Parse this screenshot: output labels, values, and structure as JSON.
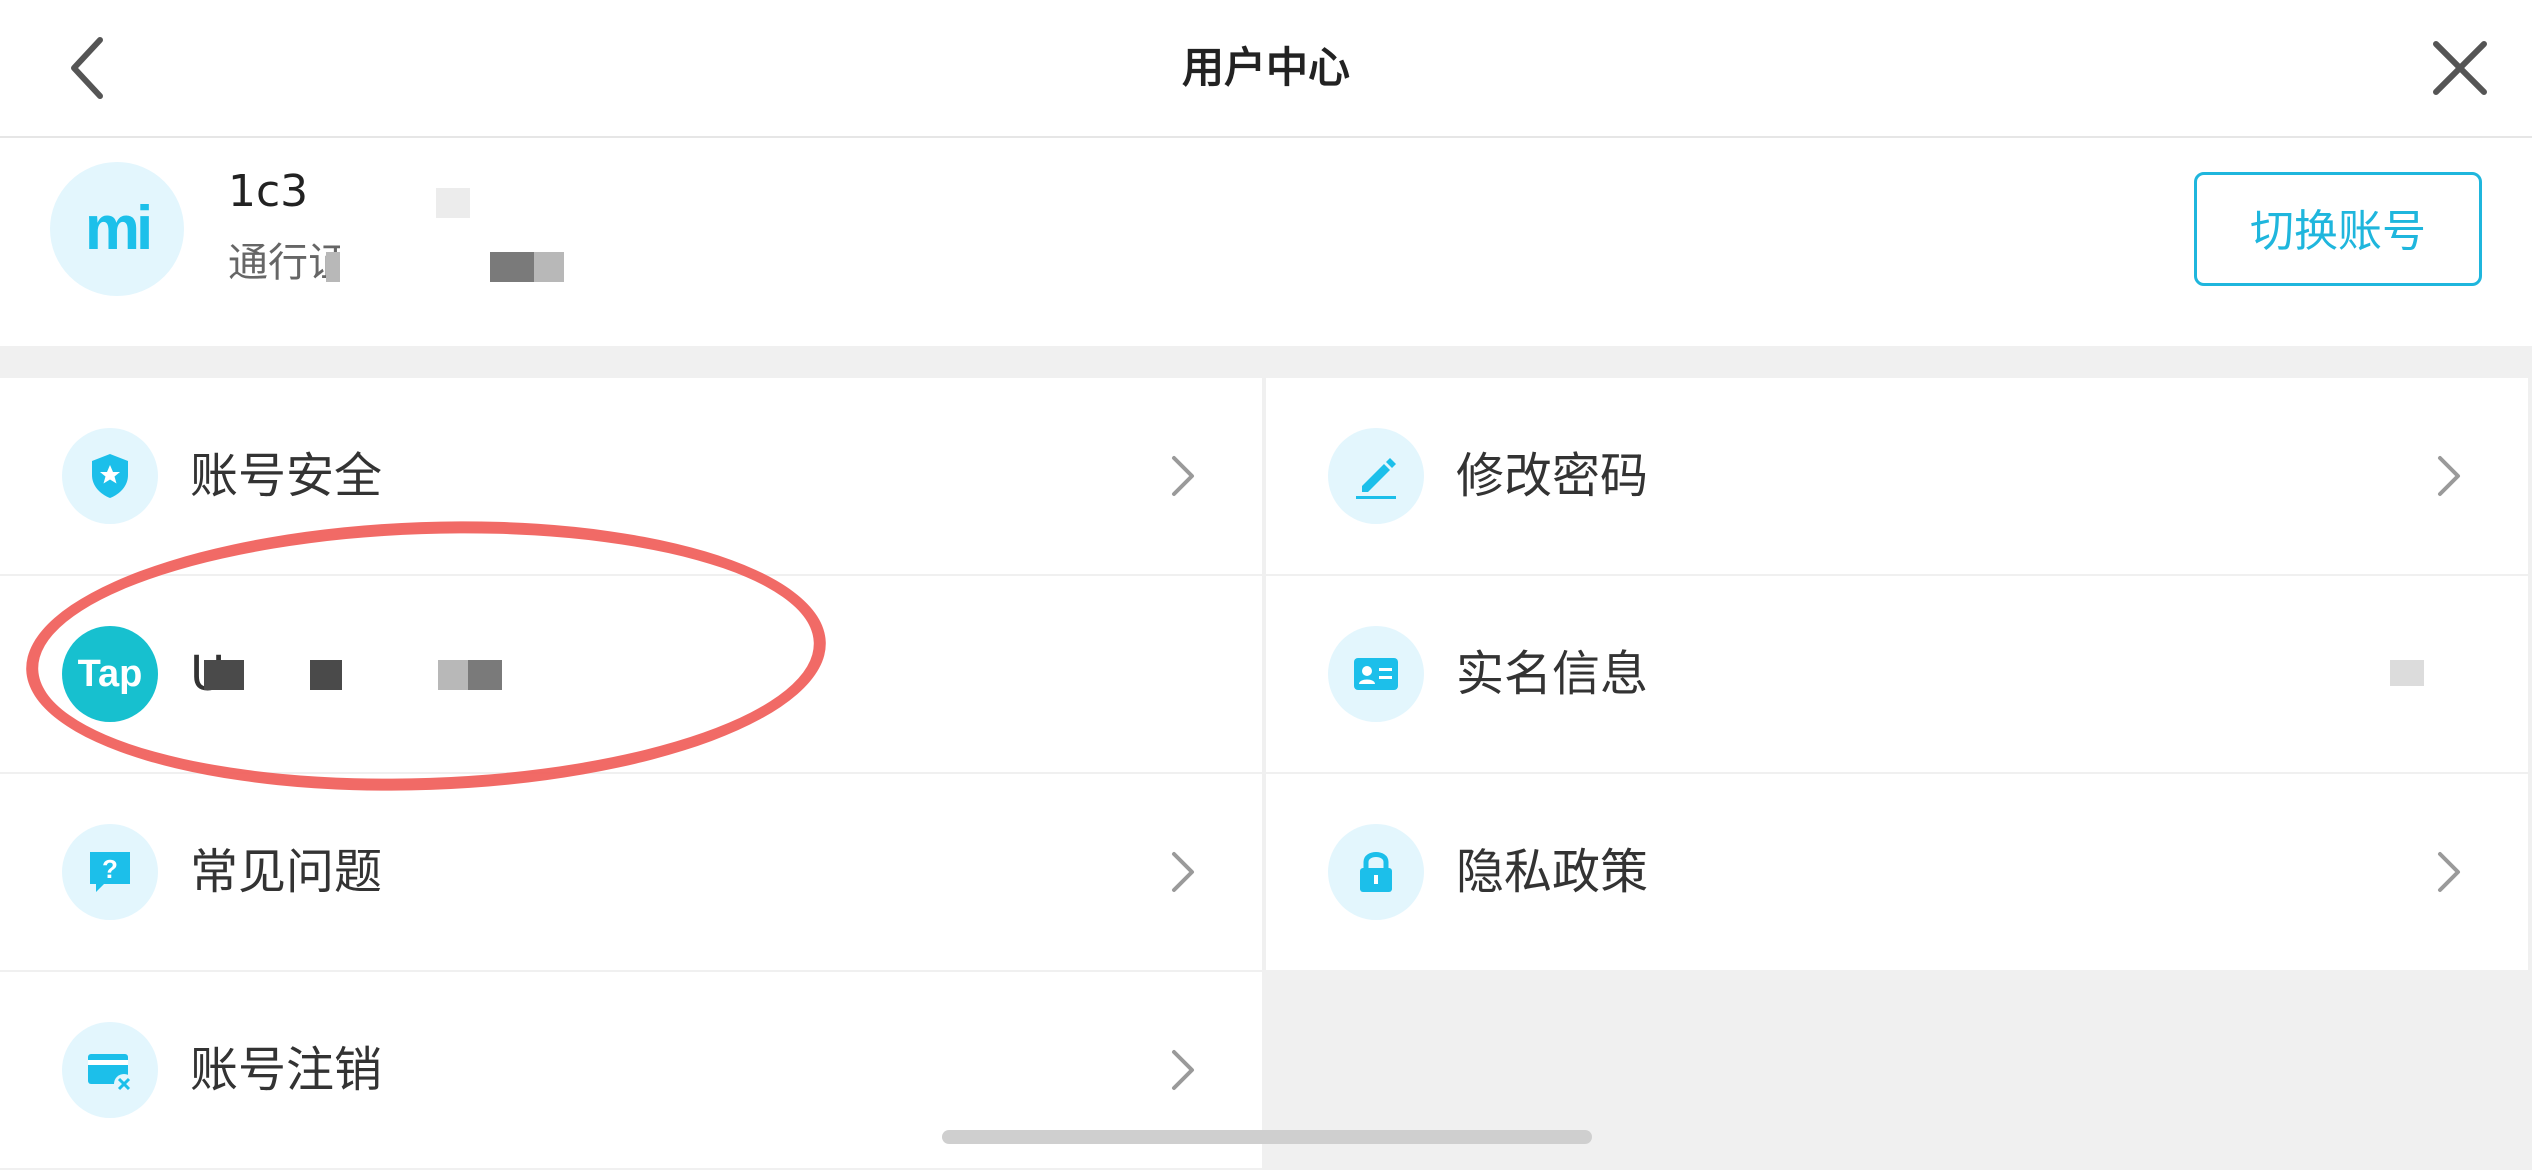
{
  "header": {
    "title": "用户中心"
  },
  "user": {
    "avatar_text": "mi",
    "id_text": "1c3",
    "id_sub": "通行证",
    "switch_label": "切换账号"
  },
  "menu": [
    {
      "label": "账号安全",
      "icon": "shield-star-icon"
    },
    {
      "label": "修改密码",
      "icon": "pencil-icon"
    },
    {
      "label": "U",
      "icon": "taptap-logo"
    },
    {
      "label": "实名信息",
      "icon": "id-card-icon"
    },
    {
      "label": "常见问题",
      "icon": "question-bubble-icon"
    },
    {
      "label": "隐私政策",
      "icon": "lock-icon"
    },
    {
      "label": "账号注销",
      "icon": "card-cancel-icon"
    }
  ],
  "tap_logo_text": "Tap",
  "colors": {
    "accent": "#1fb6dd",
    "annotation": "#ef5a55"
  }
}
